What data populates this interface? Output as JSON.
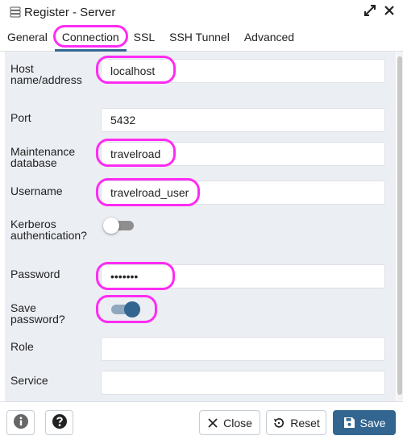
{
  "window": {
    "title": "Register - Server",
    "icon": "server-icon",
    "actions": [
      "expand-icon",
      "close-icon"
    ]
  },
  "tabs": [
    {
      "label": "General",
      "active": false
    },
    {
      "label": "Connection",
      "active": true
    },
    {
      "label": "SSL",
      "active": false
    },
    {
      "label": "SSH Tunnel",
      "active": false
    },
    {
      "label": "Advanced",
      "active": false
    }
  ],
  "form": {
    "host": {
      "label": "Host name/address",
      "value": "localhost"
    },
    "port": {
      "label": "Port",
      "value": "5432"
    },
    "maintenance_db": {
      "label": "Maintenance database",
      "value": "travelroad"
    },
    "username": {
      "label": "Username",
      "value": "travelroad_user"
    },
    "kerberos": {
      "label": "Kerberos authentication?",
      "checked": false
    },
    "password": {
      "label": "Password",
      "value": "•••••••"
    },
    "save_password": {
      "label": "Save password?",
      "checked": true
    },
    "role": {
      "label": "Role",
      "value": ""
    },
    "service": {
      "label": "Service",
      "value": ""
    }
  },
  "footer": {
    "info_icon": "info-icon",
    "help_icon": "help-icon",
    "close_label": "Close",
    "reset_label": "Reset",
    "save_label": "Save"
  },
  "colors": {
    "highlight": "#ff2bf4",
    "primary": "#326690",
    "form_background": "#ebeef3"
  }
}
